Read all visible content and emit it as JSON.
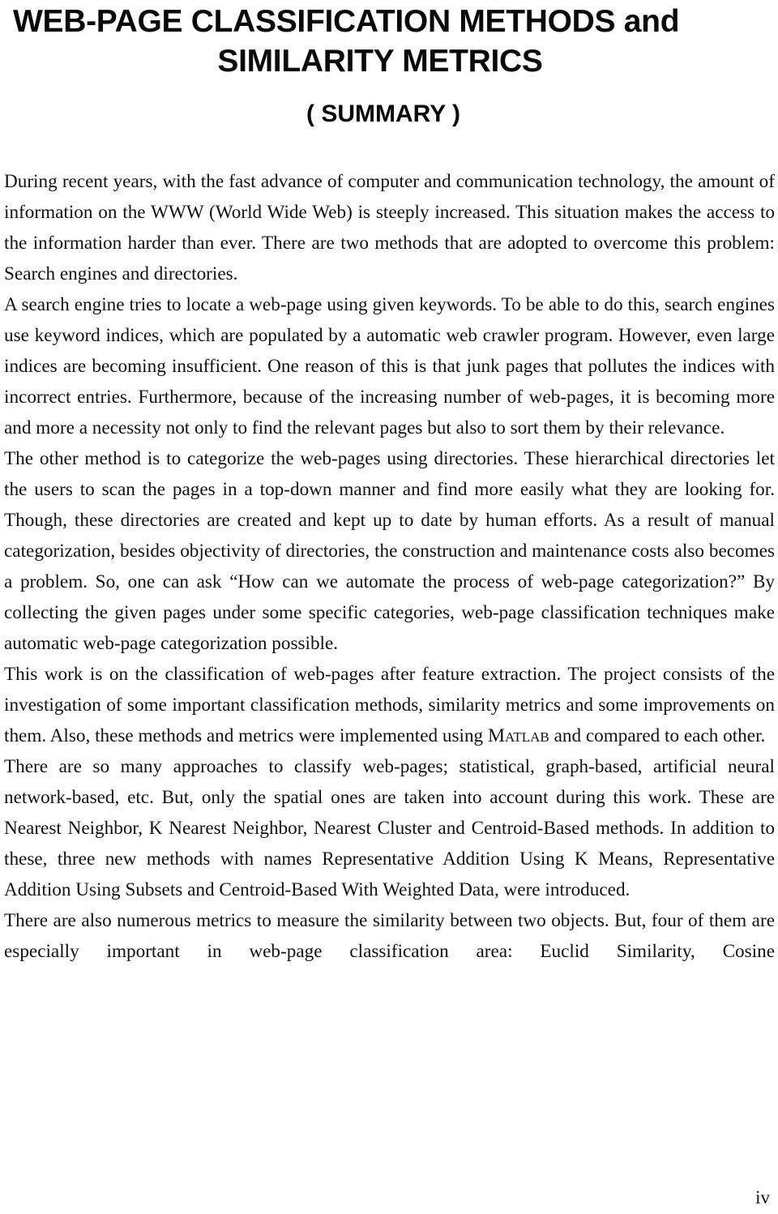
{
  "document": {
    "title_line_1": "WEB-PAGE CLASSIFICATION METHODS and",
    "title_line_2": "SIMILARITY METRICS",
    "subtitle": "( SUMMARY )",
    "page_number": "iv"
  },
  "paragraphs": {
    "p1": "During recent years, with the fast advance of computer and communication technology, the amount of information on the WWW (World Wide Web) is steeply increased. This situation makes the access to the information harder than ever. There are two methods that are adopted to overcome this problem: Search engines and directories.",
    "p2": "A search engine tries to locate a web-page using given keywords. To be able to do this, search engines use keyword indices, which are populated by a automatic web crawler program. However, even large indices are becoming insufficient. One reason of this is that junk pages that pollutes the indices with incorrect entries. Furthermore, because of the increasing number of web-pages, it is becoming more and more a necessity not only to find the relevant pages but also to sort them by their relevance.",
    "p3": "The other method is to categorize the web-pages using directories. These hierarchical directories let the users to scan the pages in a top-down manner and find more easily what they are looking for. Though, these directories are created and kept up to date by human efforts. As a result of manual categorization, besides objectivity of directories, the construction and maintenance costs also becomes a problem. So, one can ask “How can we automate the process of web-page categorization?” By collecting the given pages under some specific categories, web-page classification techniques make automatic web-page categorization possible.",
    "p4_before_matlab": "This work is on the classification of web-pages after feature extraction. The project consists of the investigation of some important classification methods, similarity metrics and some improvements on them. Also, these methods and metrics were implemented using ",
    "p4_matlab": "Matlab",
    "p4_after_matlab": " and compared to each other.",
    "p5": "There are so many approaches to classify web-pages; statistical, graph-based, artificial neural network-based, etc. But, only the spatial ones are taken into account during this work. These are Nearest Neighbor, K Nearest Neighbor, Nearest Cluster and Centroid-Based methods. In addition to these, three new methods with names Representative Addition Using K Means, Representative Addition Using Subsets and Centroid-Based With Weighted Data, were introduced.",
    "p6": "There are also numerous metrics to measure the similarity between two objects. But, four of them are especially important in web-page classification area: Euclid Similarity, Cosine"
  }
}
